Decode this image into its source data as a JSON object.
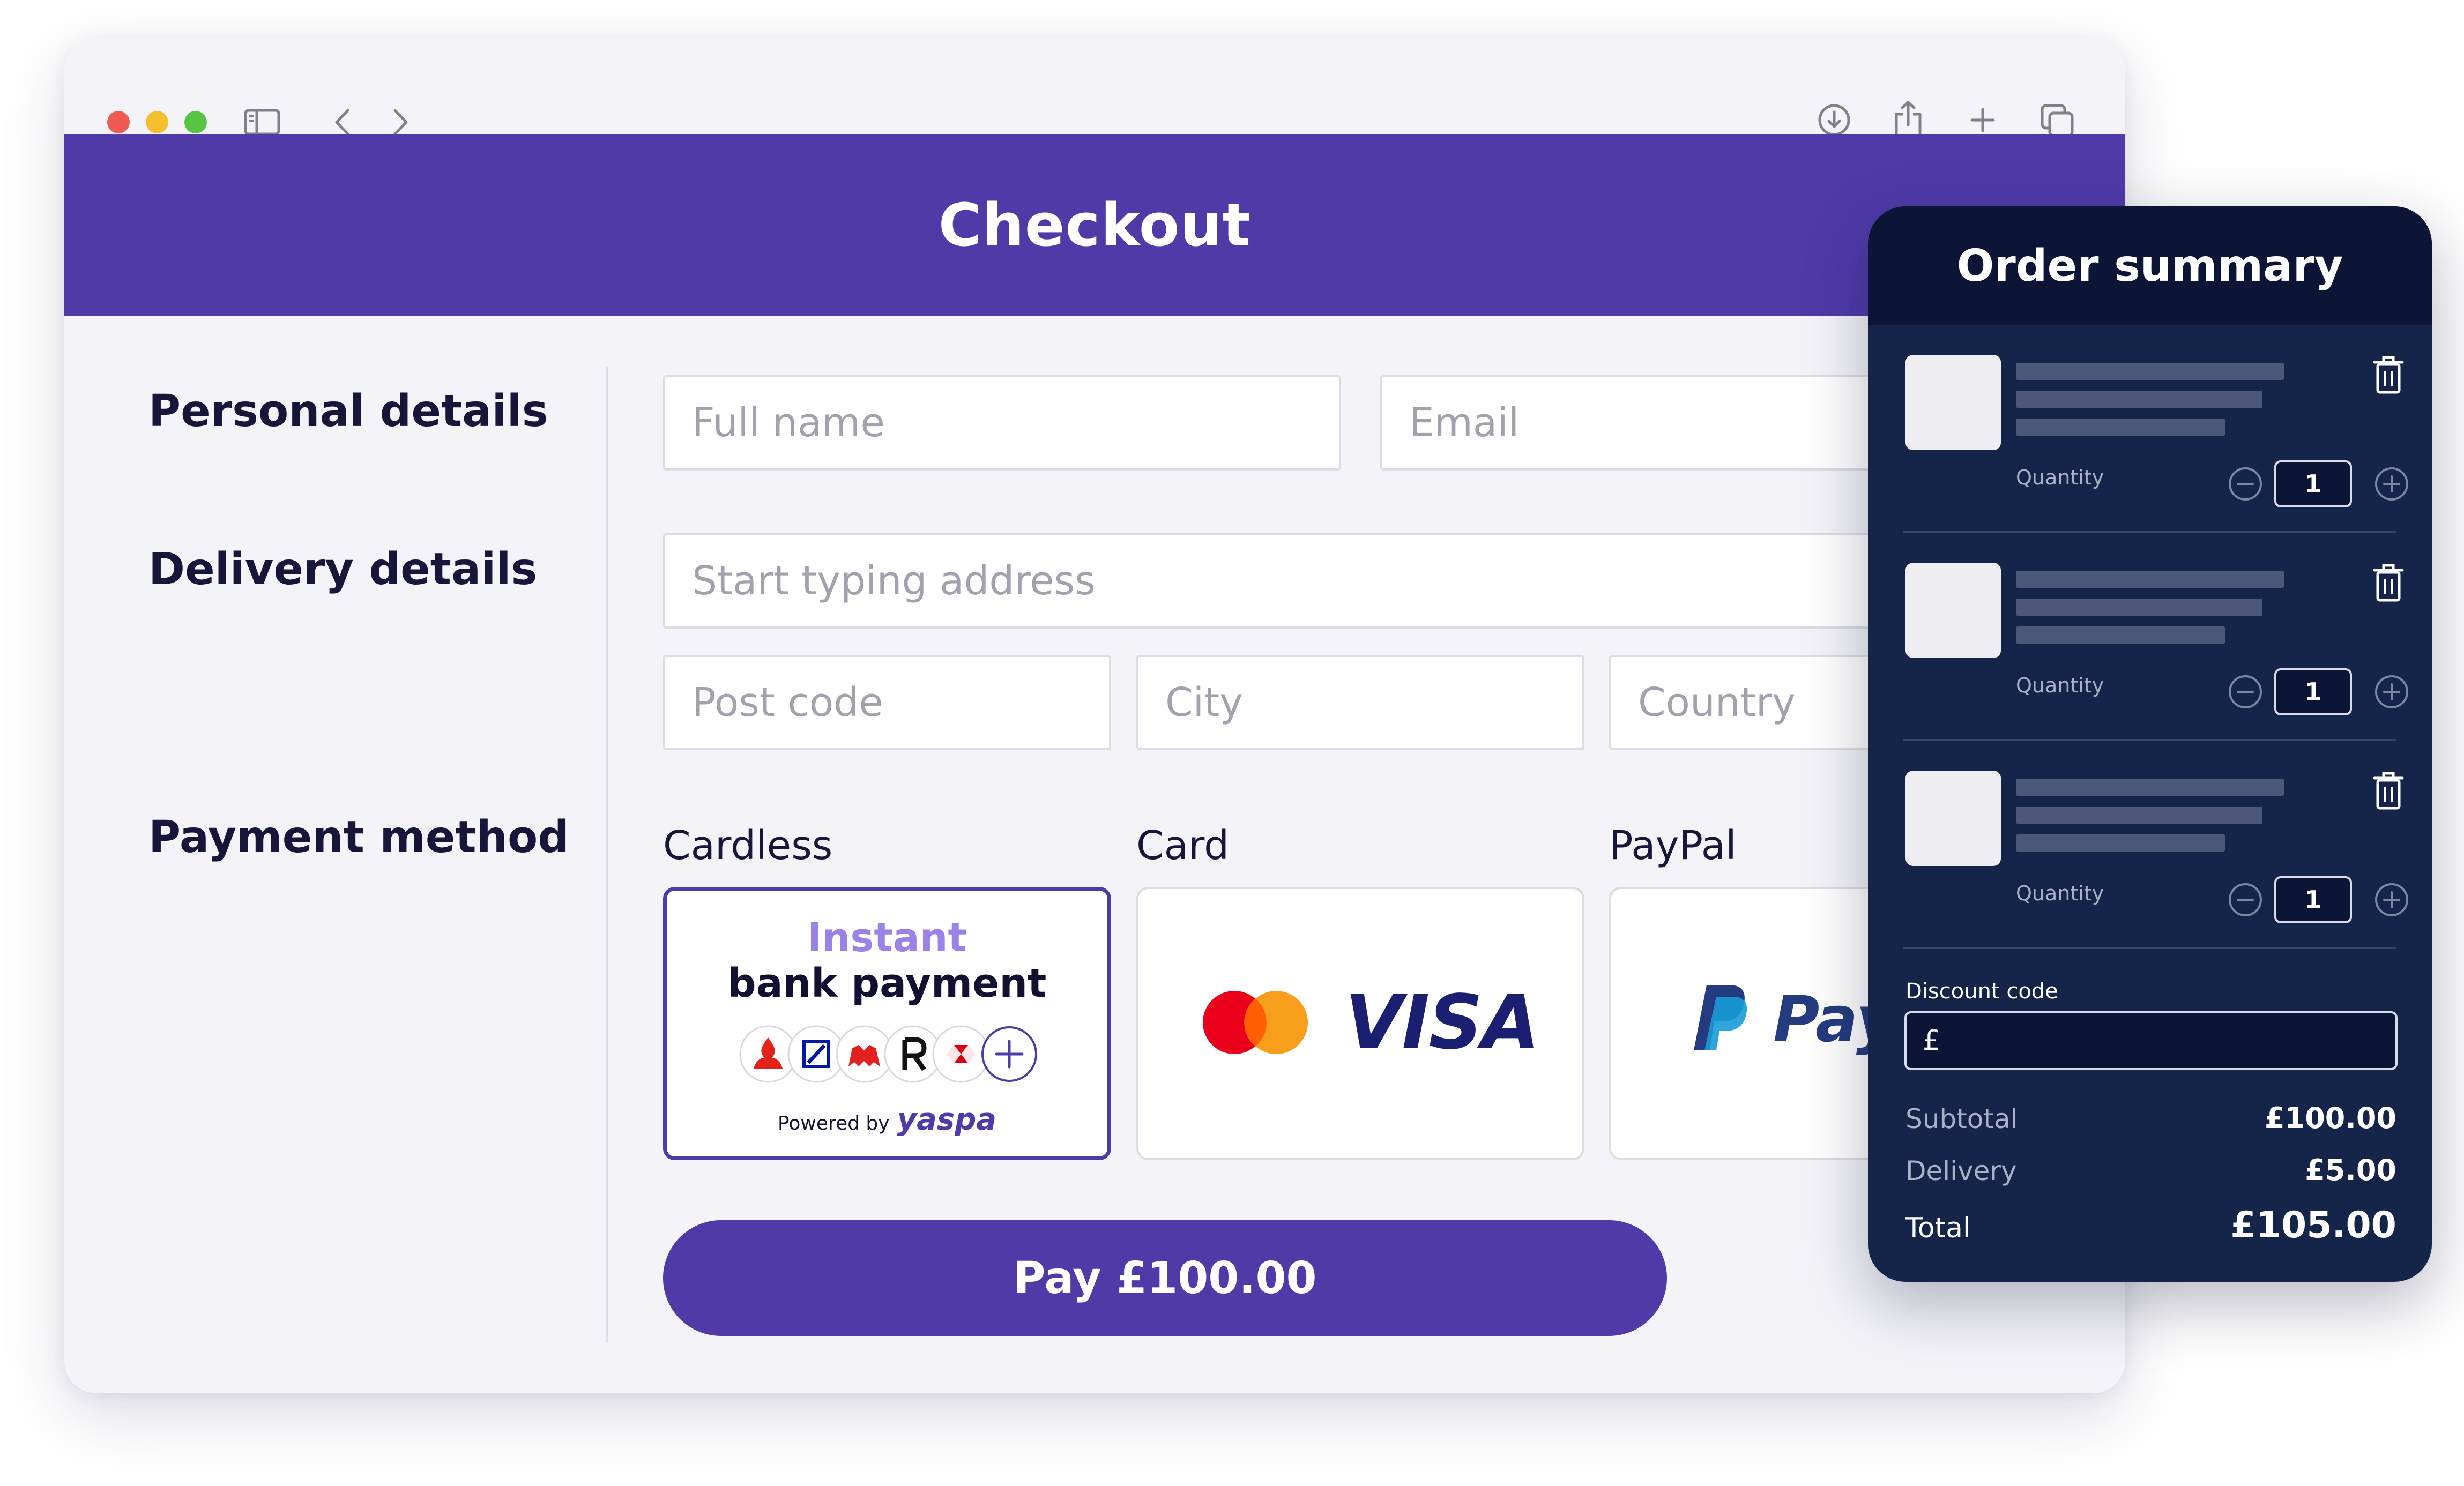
{
  "page": {
    "title": "Checkout"
  },
  "sections": {
    "personal": "Personal details",
    "delivery": "Delivery details",
    "payment": "Payment method"
  },
  "fields": {
    "full_name": {
      "placeholder": "Full name",
      "value": ""
    },
    "email": {
      "placeholder": "Email",
      "value": ""
    },
    "address": {
      "placeholder": "Start typing address",
      "value": ""
    },
    "postcode": {
      "placeholder": "Post code",
      "value": ""
    },
    "city": {
      "placeholder": "City",
      "value": ""
    },
    "country": {
      "placeholder": "Country",
      "value": ""
    }
  },
  "payment_methods": [
    {
      "label": "Cardless",
      "selected": true,
      "headline_accent": "Instant",
      "headline": "bank payment",
      "powered_by": "Powered by",
      "brand": "yaspa"
    },
    {
      "label": "Card",
      "selected": false,
      "brand": "VISA"
    },
    {
      "label": "PayPal",
      "selected": false,
      "brand": "Pay"
    }
  ],
  "pay_button": "Pay £100.00",
  "order_summary": {
    "title": "Order summary",
    "quantity_label": "Quantity",
    "items": [
      {
        "quantity": "1"
      },
      {
        "quantity": "1"
      },
      {
        "quantity": "1"
      }
    ],
    "discount_label": "Discount code",
    "discount_prefix": "£",
    "subtotal_label": "Subtotal",
    "subtotal": "£100.00",
    "delivery_label": "Delivery",
    "delivery": "£5.00",
    "total_label": "Total",
    "total": "£105.00"
  },
  "colors": {
    "brand_purple": "#4f3aa8",
    "summary_navy": "#152449",
    "summary_header": "#0c1535",
    "accent_lavender": "#9a82e6"
  },
  "icons": [
    "sidebar-toggle-icon",
    "back-chevron-icon",
    "forward-chevron-icon",
    "download-icon",
    "share-icon",
    "new-tab-plus-icon",
    "tabs-overview-icon",
    "trash-icon",
    "minus-circle-icon",
    "plus-circle-icon",
    "mastercard-logo",
    "paypal-logo",
    "bank-logos-icons"
  ]
}
